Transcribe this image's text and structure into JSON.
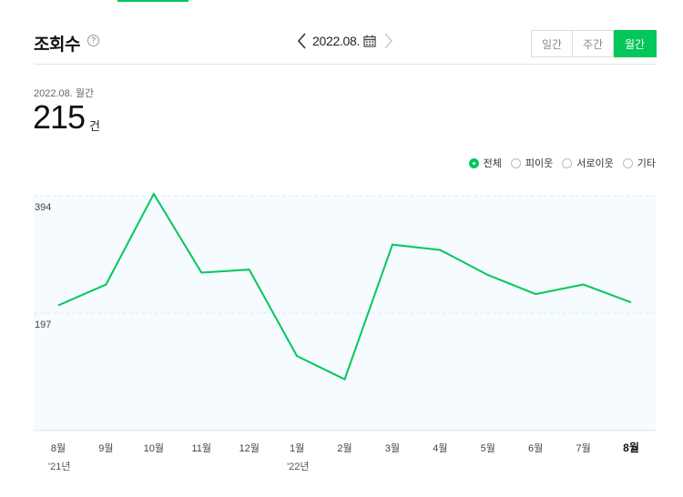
{
  "header": {
    "title": "조회수",
    "help_icon": "?",
    "date": "2022.08.",
    "period_tabs": [
      {
        "label": "일간",
        "active": false
      },
      {
        "label": "주간",
        "active": false
      },
      {
        "label": "월간",
        "active": true
      }
    ]
  },
  "summary": {
    "period_label": "2022.08. 월간",
    "value": "215",
    "unit": "건"
  },
  "legend": [
    {
      "label": "전체",
      "selected": true
    },
    {
      "label": "피이웃",
      "selected": false
    },
    {
      "label": "서로이웃",
      "selected": false
    },
    {
      "label": "기타",
      "selected": false
    }
  ],
  "colors": {
    "accent": "#03c75a",
    "plot_bg": "#f5fbfe",
    "grid": "#d8ecf5"
  },
  "chart_data": {
    "type": "line",
    "categories": [
      "8월",
      "9월",
      "10월",
      "11월",
      "12월",
      "1월",
      "2월",
      "3월",
      "4월",
      "5월",
      "6월",
      "7월",
      "8월"
    ],
    "year_labels": [
      {
        "index": 0,
        "label": "'21년"
      },
      {
        "index": 5,
        "label": "'22년"
      }
    ],
    "highlight_index": 12,
    "series": [
      {
        "values": [
          210,
          245,
          397,
          265,
          270,
          125,
          86,
          312,
          303,
          261,
          229,
          245,
          215
        ]
      }
    ],
    "yticks": [
      197,
      394
    ],
    "ylim": [
      0,
      394
    ],
    "grid": true
  }
}
